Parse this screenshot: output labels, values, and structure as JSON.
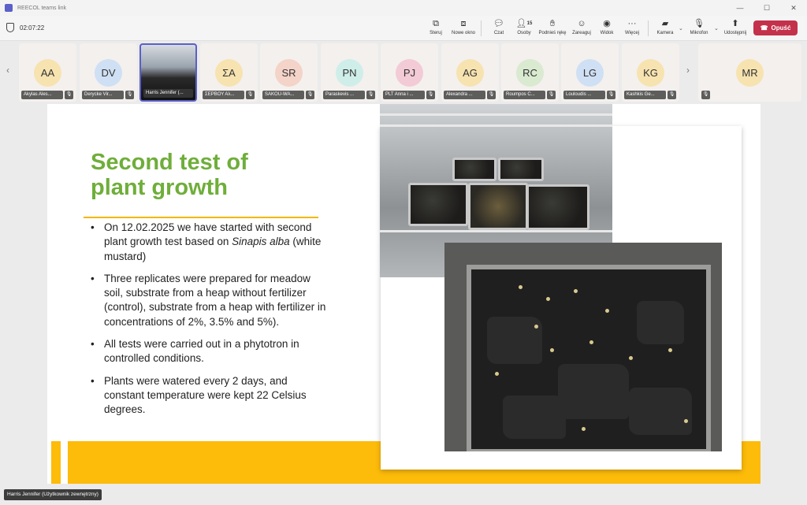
{
  "window": {
    "title": "REECOL teams link",
    "controls": [
      "—",
      "☐",
      "✕"
    ]
  },
  "toolbar": {
    "timer": "02:07:22",
    "buttons": [
      {
        "label": "Steruj",
        "icon": "share-control-icon"
      },
      {
        "label": "Nowe okno",
        "icon": "new-window-icon"
      },
      {
        "label": "Czat",
        "icon": "chat-icon"
      },
      {
        "label": "Osoby",
        "icon": "people-icon",
        "count": "15"
      },
      {
        "label": "Podnieś rękę",
        "icon": "raise-hand-icon"
      },
      {
        "label": "Zareaguj",
        "icon": "react-icon"
      },
      {
        "label": "Widok",
        "icon": "view-icon"
      },
      {
        "label": "Więcej",
        "icon": "more-icon"
      },
      {
        "label": "Kamera",
        "icon": "camera-off-icon"
      },
      {
        "label": "Mikrofon",
        "icon": "mic-off-icon"
      },
      {
        "label": "Udostępnij",
        "icon": "share-icon"
      }
    ],
    "leave_label": "Opuść",
    "leave_color": "#c4314b"
  },
  "participants": [
    {
      "initials": "AA",
      "name": "Akylas Ales...",
      "color": "#f6e3b0"
    },
    {
      "initials": "DV",
      "name": "Derycke Vir...",
      "color": "#cfe0f4"
    },
    {
      "initials": "",
      "name": "Harris Jennifer (...",
      "video": true
    },
    {
      "initials": "ΣΑ",
      "name": "ΣΕΡΒΟΥ Αλ...",
      "color": "#f6e3b0"
    },
    {
      "initials": "SR",
      "name": "SAKOU-WA...",
      "color": "#f4d3c8"
    },
    {
      "initials": "PN",
      "name": "Paraskevis ...",
      "color": "#cfeee9"
    },
    {
      "initials": "PJ",
      "name": "PLT Anna i ...",
      "color": "#f2cbd6"
    },
    {
      "initials": "AG",
      "name": "Alexandra ...",
      "color": "#f6e3b0"
    },
    {
      "initials": "RC",
      "name": "Roumpos C...",
      "color": "#d9ead0"
    },
    {
      "initials": "LG",
      "name": "Louloudis ...",
      "color": "#cfe0f4"
    },
    {
      "initials": "KG",
      "name": "Kashkis Ge...",
      "color": "#f6e3b0"
    },
    {
      "initials": "MR",
      "name": "",
      "color": "#f6e3b0"
    }
  ],
  "slide": {
    "title_line1": "Second test of",
    "title_line2": "plant growth",
    "bullet1_pre": "On 12.02.2025 we have started with second plant growth test based on ",
    "bullet1_italic": "Sinapis alba",
    "bullet1_post": " (white mustard)",
    "bullet2": "Three replicates were prepared for meadow soil, substrate from a heap without fertilizer (control), substrate from a heap with fertilizer in concentrations of 2%, 3.5% and 5%).",
    "bullet3": "All tests were carried out in a phytotron in controlled conditions.",
    "bullet4": "Plants were watered every 2 days, and constant temperature were kept 22 Celsius degrees.",
    "title_color": "#6fae3a",
    "accent_color": "#fdbb0a"
  },
  "tooltip": "Harris Jennifer (Użytkownik zewnętrzny)"
}
